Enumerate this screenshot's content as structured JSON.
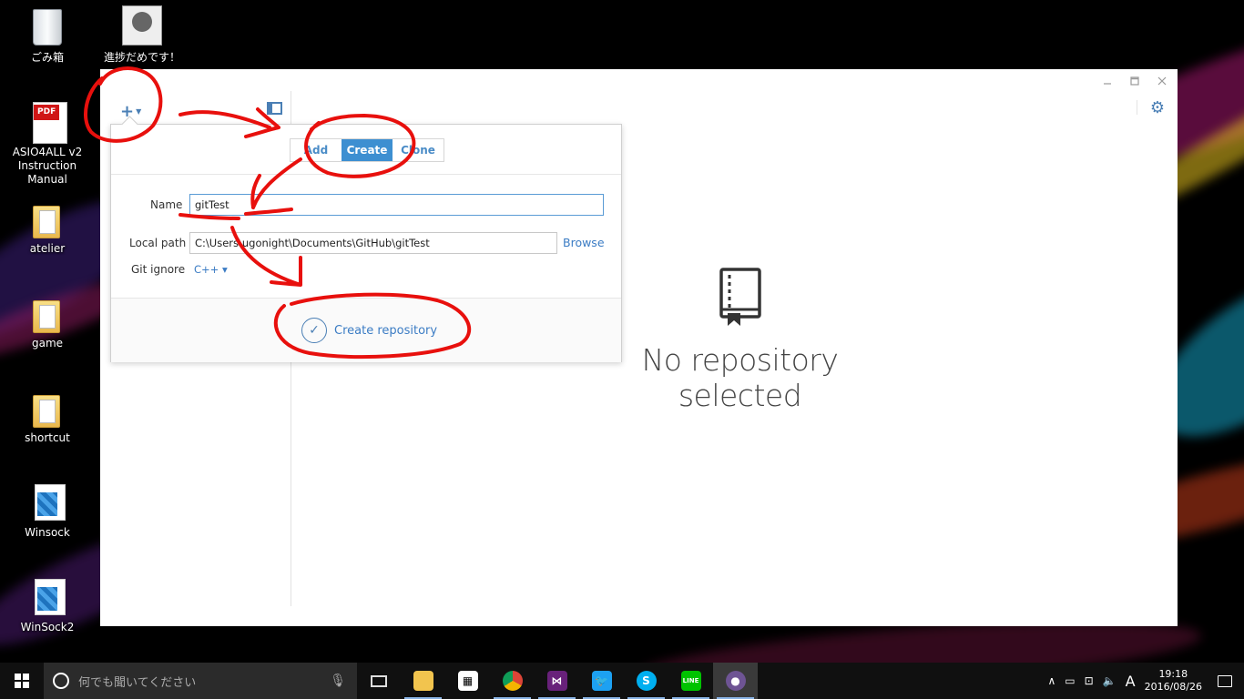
{
  "desktop": {
    "icons": [
      {
        "label": "ごみ箱"
      },
      {
        "label": "進捗だめです！"
      },
      {
        "label": "ASIO4ALL v2 Instruction Manual",
        "badge": "PDF"
      },
      {
        "label": "atelier"
      },
      {
        "label": "game"
      },
      {
        "label": "shortcut"
      },
      {
        "label": "Winsock"
      },
      {
        "label": "WinSock2"
      }
    ]
  },
  "app": {
    "empty_state": "No repository selected",
    "popover": {
      "tabs": [
        "Add",
        "Create",
        "Clone"
      ],
      "active_tab": "Create",
      "name_label": "Name",
      "name_value": "gitTest",
      "path_label": "Local path",
      "path_value": "C:\\Users\\ugonight\\Documents\\GitHub\\gitTest",
      "browse_label": "Browse",
      "gitignore_label": "Git ignore",
      "gitignore_value": "C++ ▾",
      "submit_label": "Create repository"
    }
  },
  "taskbar": {
    "search_placeholder": "何でも聞いてください",
    "ime": "A",
    "time": "19:18",
    "date": "2016/08/26"
  },
  "colors": {
    "accent": "#3d8fd1",
    "link": "#3b7cc4",
    "annotation": "#e8100d"
  }
}
